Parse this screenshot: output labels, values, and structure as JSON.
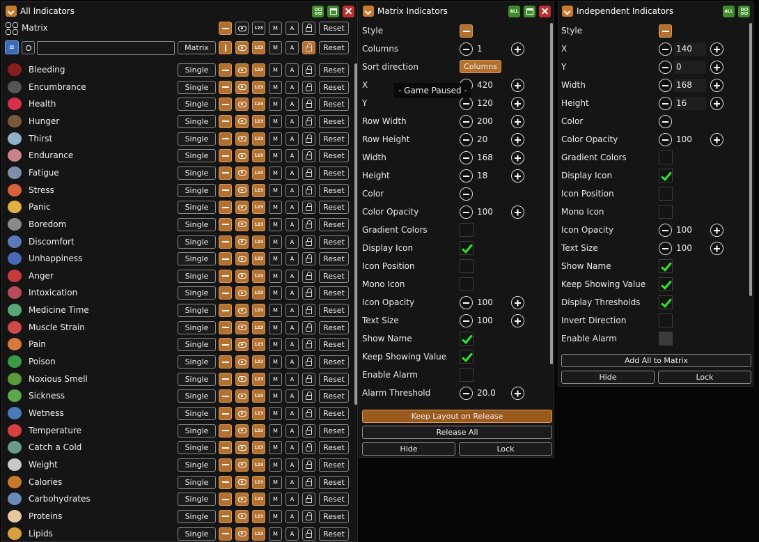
{
  "all": {
    "title": "All Indicators",
    "matrix_label": "Matrix",
    "reset": "Reset",
    "matrix_btn": "Matrix",
    "search_placeholder": "",
    "m": "M",
    "a": "A",
    "num": "123",
    "single": "Single",
    "rows": [
      {
        "name": "Bleeding",
        "color": "#8b1e1e"
      },
      {
        "name": "Encumbrance",
        "color": "#555555"
      },
      {
        "name": "Health",
        "color": "#d8304a"
      },
      {
        "name": "Hunger",
        "color": "#7a5a3a"
      },
      {
        "name": "Thirst",
        "color": "#8fb0c8"
      },
      {
        "name": "Endurance",
        "color": "#c9838d"
      },
      {
        "name": "Fatigue",
        "color": "#7d8fae"
      },
      {
        "name": "Stress",
        "color": "#d8603a"
      },
      {
        "name": "Panic",
        "color": "#e0b040"
      },
      {
        "name": "Boredom",
        "color": "#8a8a8a"
      },
      {
        "name": "Discomfort",
        "color": "#5a7ab8"
      },
      {
        "name": "Unhappiness",
        "color": "#4a6ab8"
      },
      {
        "name": "Anger",
        "color": "#c83a3a"
      },
      {
        "name": "Intoxication",
        "color": "#b84a5a"
      },
      {
        "name": "Medicine Time",
        "color": "#58a878"
      },
      {
        "name": "Muscle Strain",
        "color": "#d04a4a"
      },
      {
        "name": "Pain",
        "color": "#d8783a"
      },
      {
        "name": "Poison",
        "color": "#3a9a4a"
      },
      {
        "name": "Noxious Smell",
        "color": "#5a9a3a"
      },
      {
        "name": "Sickness",
        "color": "#5aa84a"
      },
      {
        "name": "Wetness",
        "color": "#4a7ab8"
      },
      {
        "name": "Temperature",
        "color": "#d84040"
      },
      {
        "name": "Catch a Cold",
        "color": "#6a9a8a"
      },
      {
        "name": "Weight",
        "color": "#c8c8c8"
      },
      {
        "name": "Calories",
        "color": "#c87a2a"
      },
      {
        "name": "Carbohydrates",
        "color": "#6a8ab8"
      },
      {
        "name": "Proteins",
        "color": "#e8c8a0"
      },
      {
        "name": "Lipids",
        "color": "#d8a040"
      }
    ]
  },
  "matrix": {
    "title": "Matrix Indicators",
    "all": "ALL",
    "paused": "- Game Paused -",
    "style": "Style",
    "columns": "Columns",
    "columns_val": "1",
    "sort": "Sort direction",
    "sort_val": "Columns",
    "x": "X",
    "x_val": "420",
    "y": "Y",
    "y_val": "120",
    "row_width": "Row Width",
    "row_width_val": "200",
    "row_height": "Row Height",
    "row_height_val": "20",
    "width": "Width",
    "width_val": "168",
    "height": "Height",
    "height_val": "18",
    "color": "Color",
    "opacity": "Color Opacity",
    "opacity_val": "100",
    "gradient": "Gradient Colors",
    "display_icon": "Display Icon",
    "icon_pos": "Icon Position",
    "mono": "Mono Icon",
    "icon_op": "Icon Opacity",
    "icon_op_val": "100",
    "text_size": "Text Size",
    "text_size_val": "100",
    "show_name": "Show Name",
    "keep": "Keep Showing Value",
    "alarm": "Enable Alarm",
    "alarm_thr": "Alarm Threshold",
    "alarm_thr_val": "20.0",
    "keep_layout": "Keep Layout on Release",
    "release": "Release All",
    "hide": "Hide",
    "lock": "Lock"
  },
  "ind": {
    "title": "Independent Indicators",
    "all": "ALL",
    "style": "Style",
    "x": "X",
    "x_val": "140",
    "y": "Y",
    "y_val": "0",
    "width": "Width",
    "width_val": "168",
    "height": "Height",
    "height_val": "16",
    "color": "Color",
    "opacity": "Color Opacity",
    "opacity_val": "100",
    "gradient": "Gradient Colors",
    "display_icon": "Display Icon",
    "icon_pos": "Icon Position",
    "mono": "Mono Icon",
    "icon_op": "Icon Opacity",
    "icon_op_val": "100",
    "text_size": "Text Size",
    "text_size_val": "100",
    "show_name": "Show Name",
    "keep": "Keep Showing Value",
    "thresholds": "Display Thresholds",
    "invert": "Invert Direction",
    "alarm": "Enable Alarm",
    "add_all": "Add All to Matrix",
    "hide": "Hide",
    "lock": "Lock"
  }
}
